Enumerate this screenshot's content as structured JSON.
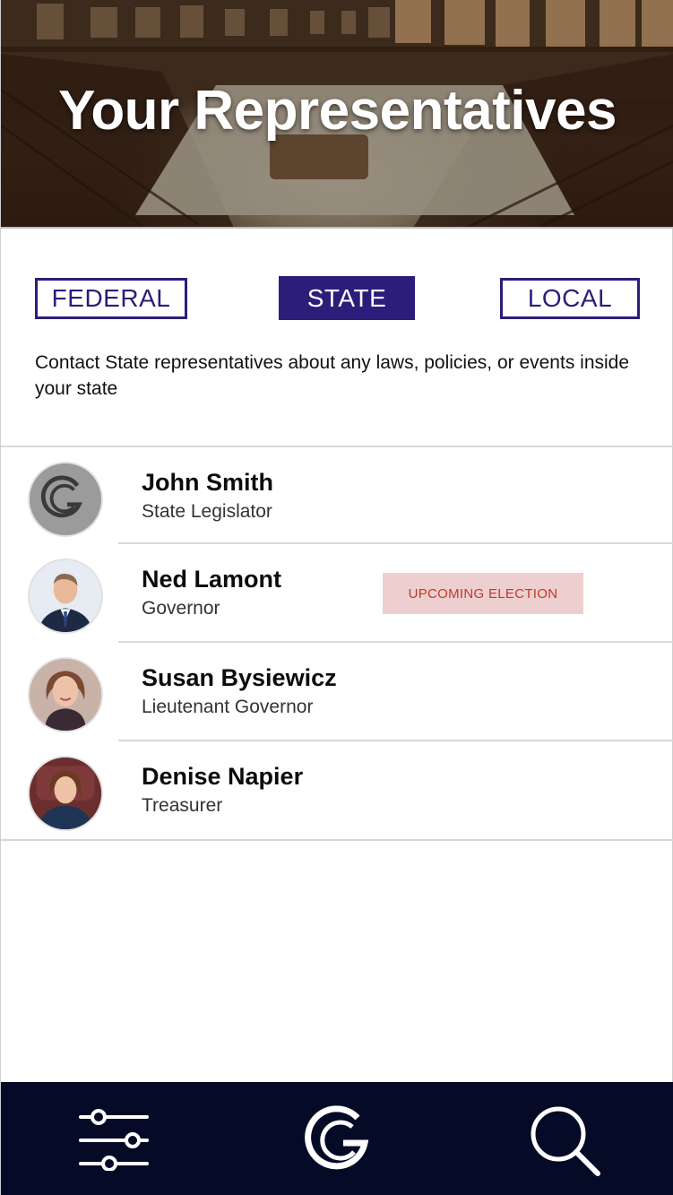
{
  "hero": {
    "title": "Your Representatives"
  },
  "tabs": [
    {
      "label": "FEDERAL",
      "active": false
    },
    {
      "label": "STATE",
      "active": true
    },
    {
      "label": "LOCAL",
      "active": false
    }
  ],
  "description": "Contact State representatives about any laws, policies, or events inside your state",
  "representatives": [
    {
      "name": "John Smith",
      "title": "State Legislator",
      "avatar": "g-logo-placeholder"
    },
    {
      "name": "Ned Lamont",
      "title": "Governor",
      "avatar": "photo",
      "badge": "UPCOMING ELECTION"
    },
    {
      "name": "Susan Bysiewicz",
      "title": "Lieutenant Governor",
      "avatar": "photo"
    },
    {
      "name": "Denise Napier",
      "title": "Treasurer",
      "avatar": "photo"
    }
  ],
  "bottom_nav": {
    "items": [
      {
        "icon": "sliders-icon"
      },
      {
        "icon": "g-logo-icon"
      },
      {
        "icon": "search-icon"
      }
    ]
  },
  "colors": {
    "primary": "#2d1d7a",
    "nav_background": "#050b26",
    "badge_background": "#eecfcf",
    "badge_text": "#c0392b"
  }
}
